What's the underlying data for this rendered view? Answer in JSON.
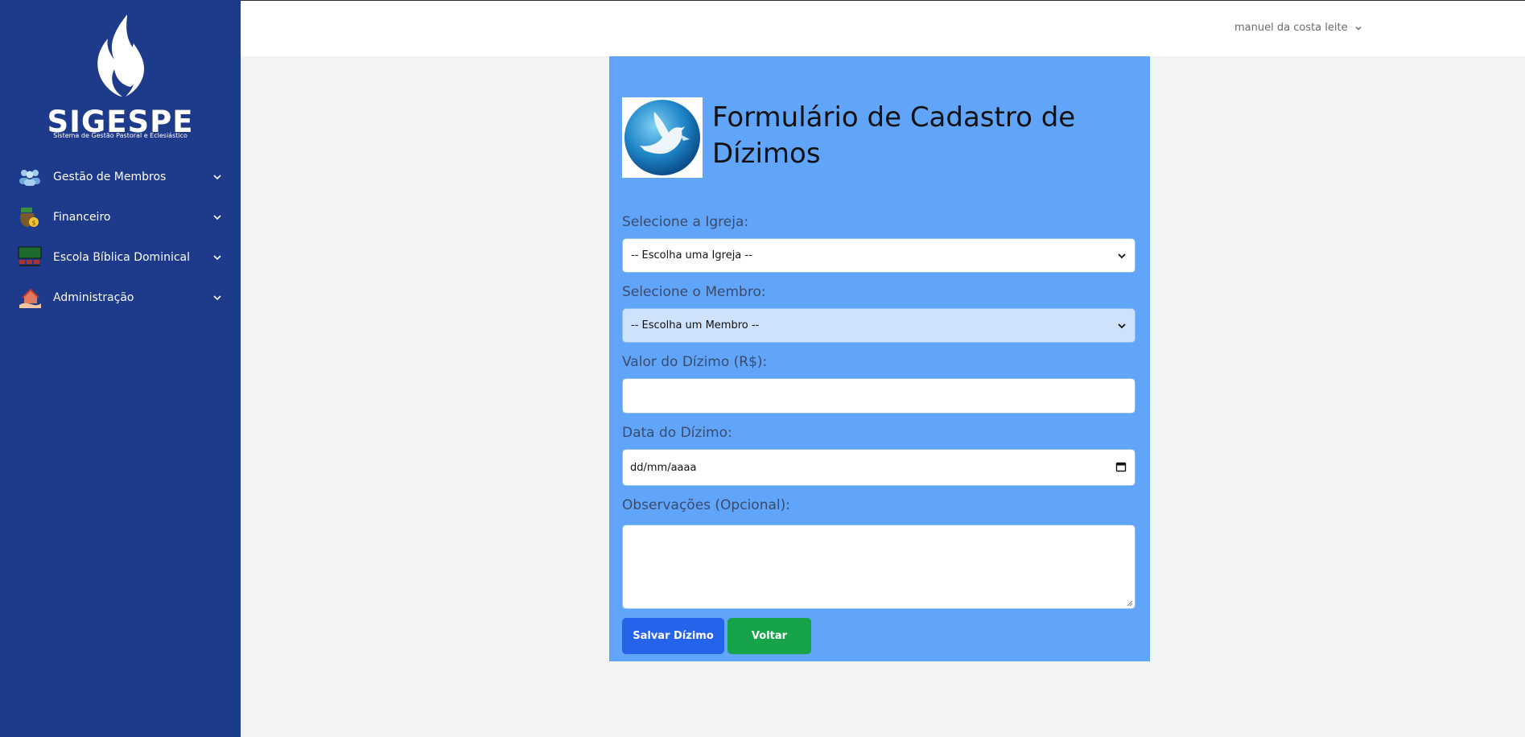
{
  "brand": {
    "name": "SIGESPE",
    "tagline": "Sistema de Gestão Pastoral e Eclesiástico"
  },
  "sidebar": {
    "items": [
      {
        "label": "Gestão de Membros",
        "icon": "members-icon"
      },
      {
        "label": "Financeiro",
        "icon": "money-bag-icon"
      },
      {
        "label": "Escola Bíblica Dominical",
        "icon": "classroom-icon"
      },
      {
        "label": "Administração",
        "icon": "admin-house-icon"
      }
    ]
  },
  "topbar": {
    "user_name": "manuel da costa leite"
  },
  "form": {
    "title": "Formulário de Cadastro de Dízimos",
    "logo_icon": "dove-globe-logo",
    "church": {
      "label": "Selecione a Igreja:",
      "selected": "-- Escolha uma Igreja --"
    },
    "member": {
      "label": "Selecione o Membro:",
      "selected": "-- Escolha um Membro --"
    },
    "amount": {
      "label": "Valor do Dízimo (R$):",
      "value": ""
    },
    "date": {
      "label": "Data do Dízimo:",
      "placeholder": "dd/mm/aaaa"
    },
    "notes": {
      "label": "Observações (Opcional):",
      "value": ""
    },
    "save_label": "Salvar Dízimo",
    "back_label": "Voltar"
  },
  "colors": {
    "sidebar": "#1e3a8a",
    "panel": "#60a5fa",
    "save_button": "#2563eb",
    "back_button": "#16a34a"
  }
}
